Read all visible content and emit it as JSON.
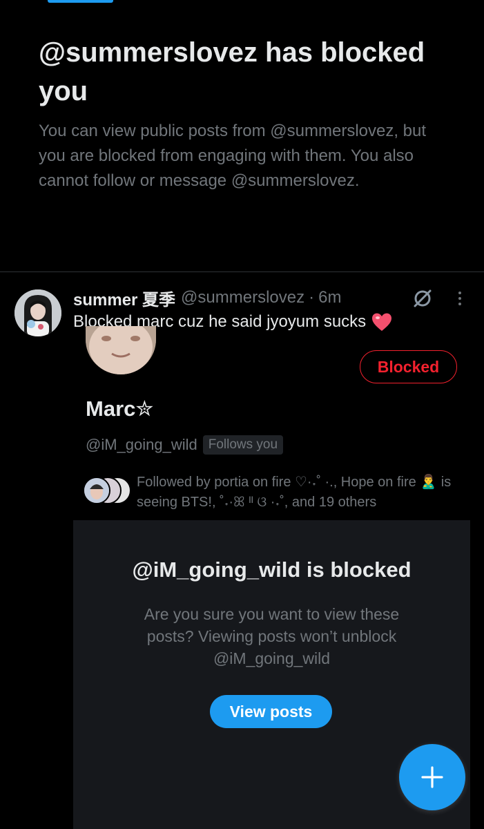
{
  "blocked_notice": {
    "title": "@summerslovez has blocked you",
    "description": "You can view public posts from @summerslovez, but you are blocked from engaging with them. You also cannot follow or message @summerslovez."
  },
  "post": {
    "author_name": "summer 夏季",
    "author_handle": "@summerslovez",
    "separator": "·",
    "time": "6m",
    "text": "Blocked marc cuz he said jyoyum sucks",
    "emoji_icon": "heart-icon"
  },
  "embedded_profile": {
    "name": "Marc✮",
    "handle": "@iM_going_wild",
    "follows_you_badge": "Follows you",
    "blocked_button": "Blocked",
    "followed_by": "Followed by portia on fire ♡·˖˚ ·., Hope on fire 🙎‍♂️ is seeing BTS!, ˚˖·ꕤ ᴵᴵ ଓ ·˖˚, and 19 others",
    "blocked_panel": {
      "title": "@iM_going_wild is blocked",
      "description": "Are you sure you want to view these posts? Viewing posts won’t unblock @iM_going_wild",
      "view_button": "View posts"
    }
  },
  "fab": {
    "icon": "plus-icon"
  },
  "colors": {
    "accent": "#1d9bf0",
    "danger": "#f4212e",
    "background": "#000000",
    "secondary_text": "#71767b",
    "panel_bg": "#16181c"
  }
}
